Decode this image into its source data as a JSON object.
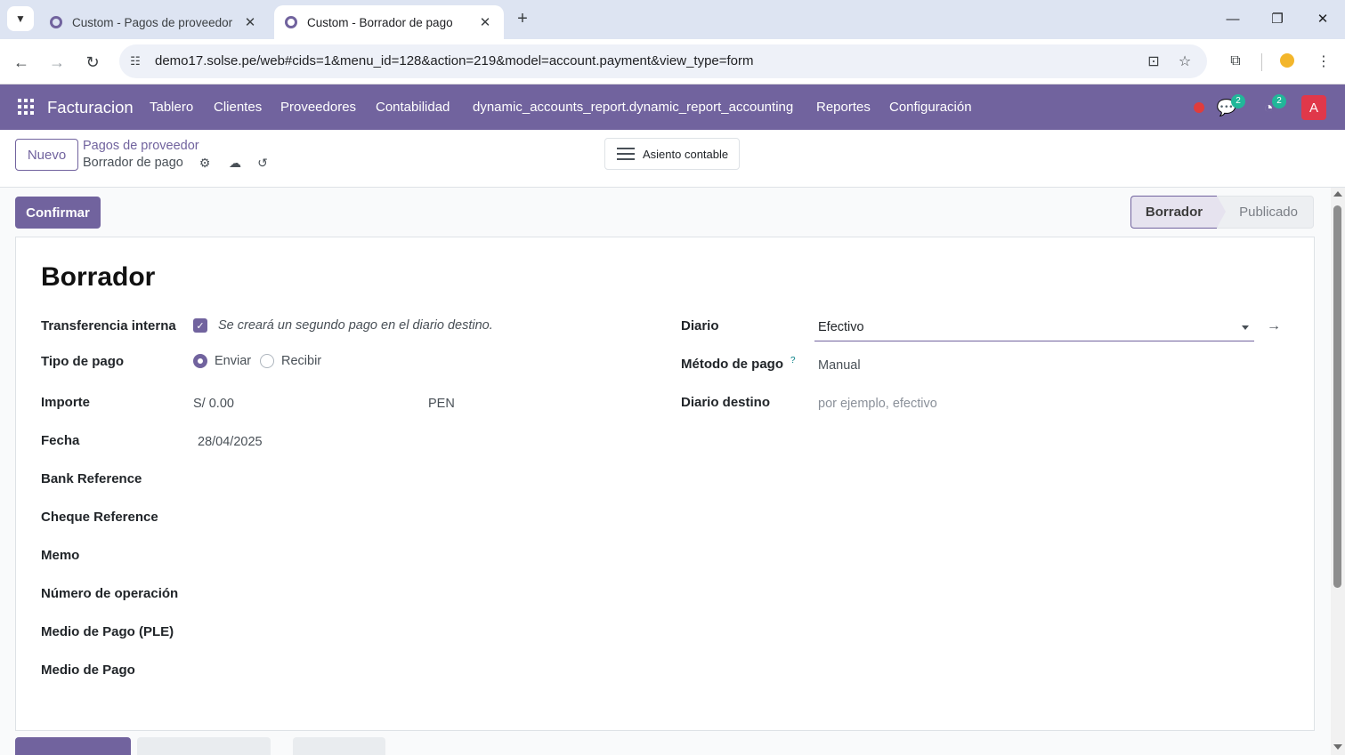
{
  "browser": {
    "tabs": [
      {
        "title": "Custom - Pagos de proveedor",
        "active": false
      },
      {
        "title": "Custom - Borrador de pago",
        "active": true
      }
    ],
    "close_glyph": "✕",
    "new_tab_glyph": "+",
    "url": "demo17.solse.pe/web#cids=1&menu_id=128&action=219&model=account.payment&view_type=form",
    "icons": [
      "back-icon",
      "forward-icon",
      "reload-icon",
      "site-settings-icon",
      "install-icon",
      "bookmark-star-icon",
      "extensions-icon",
      "profile-icon",
      "kebab-menu-icon",
      "minimize-icon",
      "restore-icon",
      "close-window-icon"
    ]
  },
  "navbar": {
    "app_name": "Facturacion",
    "menu": [
      "Tablero",
      "Clientes",
      "Proveedores",
      "Contabilidad",
      "dynamic_accounts_report.dynamic_report_accounting",
      "Reportes",
      "Configuración"
    ],
    "messages_count": "2",
    "activities_count": "2",
    "avatar_letter": "A",
    "color": "#71639e"
  },
  "control_panel": {
    "new_label": "Nuevo",
    "breadcrumb_parent": "Pagos de proveedor",
    "breadcrumb_current": "Borrador de pago",
    "journal_entry_label": "Asiento contable"
  },
  "form": {
    "confirm_label": "Confirmar",
    "status": {
      "current": "Borrador",
      "next": "Publicado"
    },
    "title": "Borrador",
    "left": {
      "internal_transfer_label": "Transferencia interna",
      "internal_transfer_checked": true,
      "internal_transfer_note": "Se creará un segundo pago en el diario destino.",
      "payment_type_label": "Tipo de pago",
      "payment_type_send": "Enviar",
      "payment_type_receive": "Recibir",
      "payment_type_selected": "Enviar",
      "amount_label": "Importe",
      "amount_value": "S/ 0.00",
      "currency": "PEN",
      "date_label": "Fecha",
      "date_value": "28/04/2025",
      "bank_ref_label": "Bank Reference",
      "cheque_ref_label": "Cheque Reference",
      "memo_label": "Memo",
      "operation_number_label": "Número de operación",
      "ple_payment_label": "Medio de Pago (PLE)",
      "payment_medium_label": "Medio de Pago"
    },
    "right": {
      "journal_label": "Diario",
      "journal_value": "Efectivo",
      "payment_method_label": "Método de pago",
      "payment_method_help": "?",
      "payment_method_value": "Manual",
      "destination_journal_label": "Diario destino",
      "destination_journal_placeholder": "por ejemplo, efectivo"
    }
  }
}
